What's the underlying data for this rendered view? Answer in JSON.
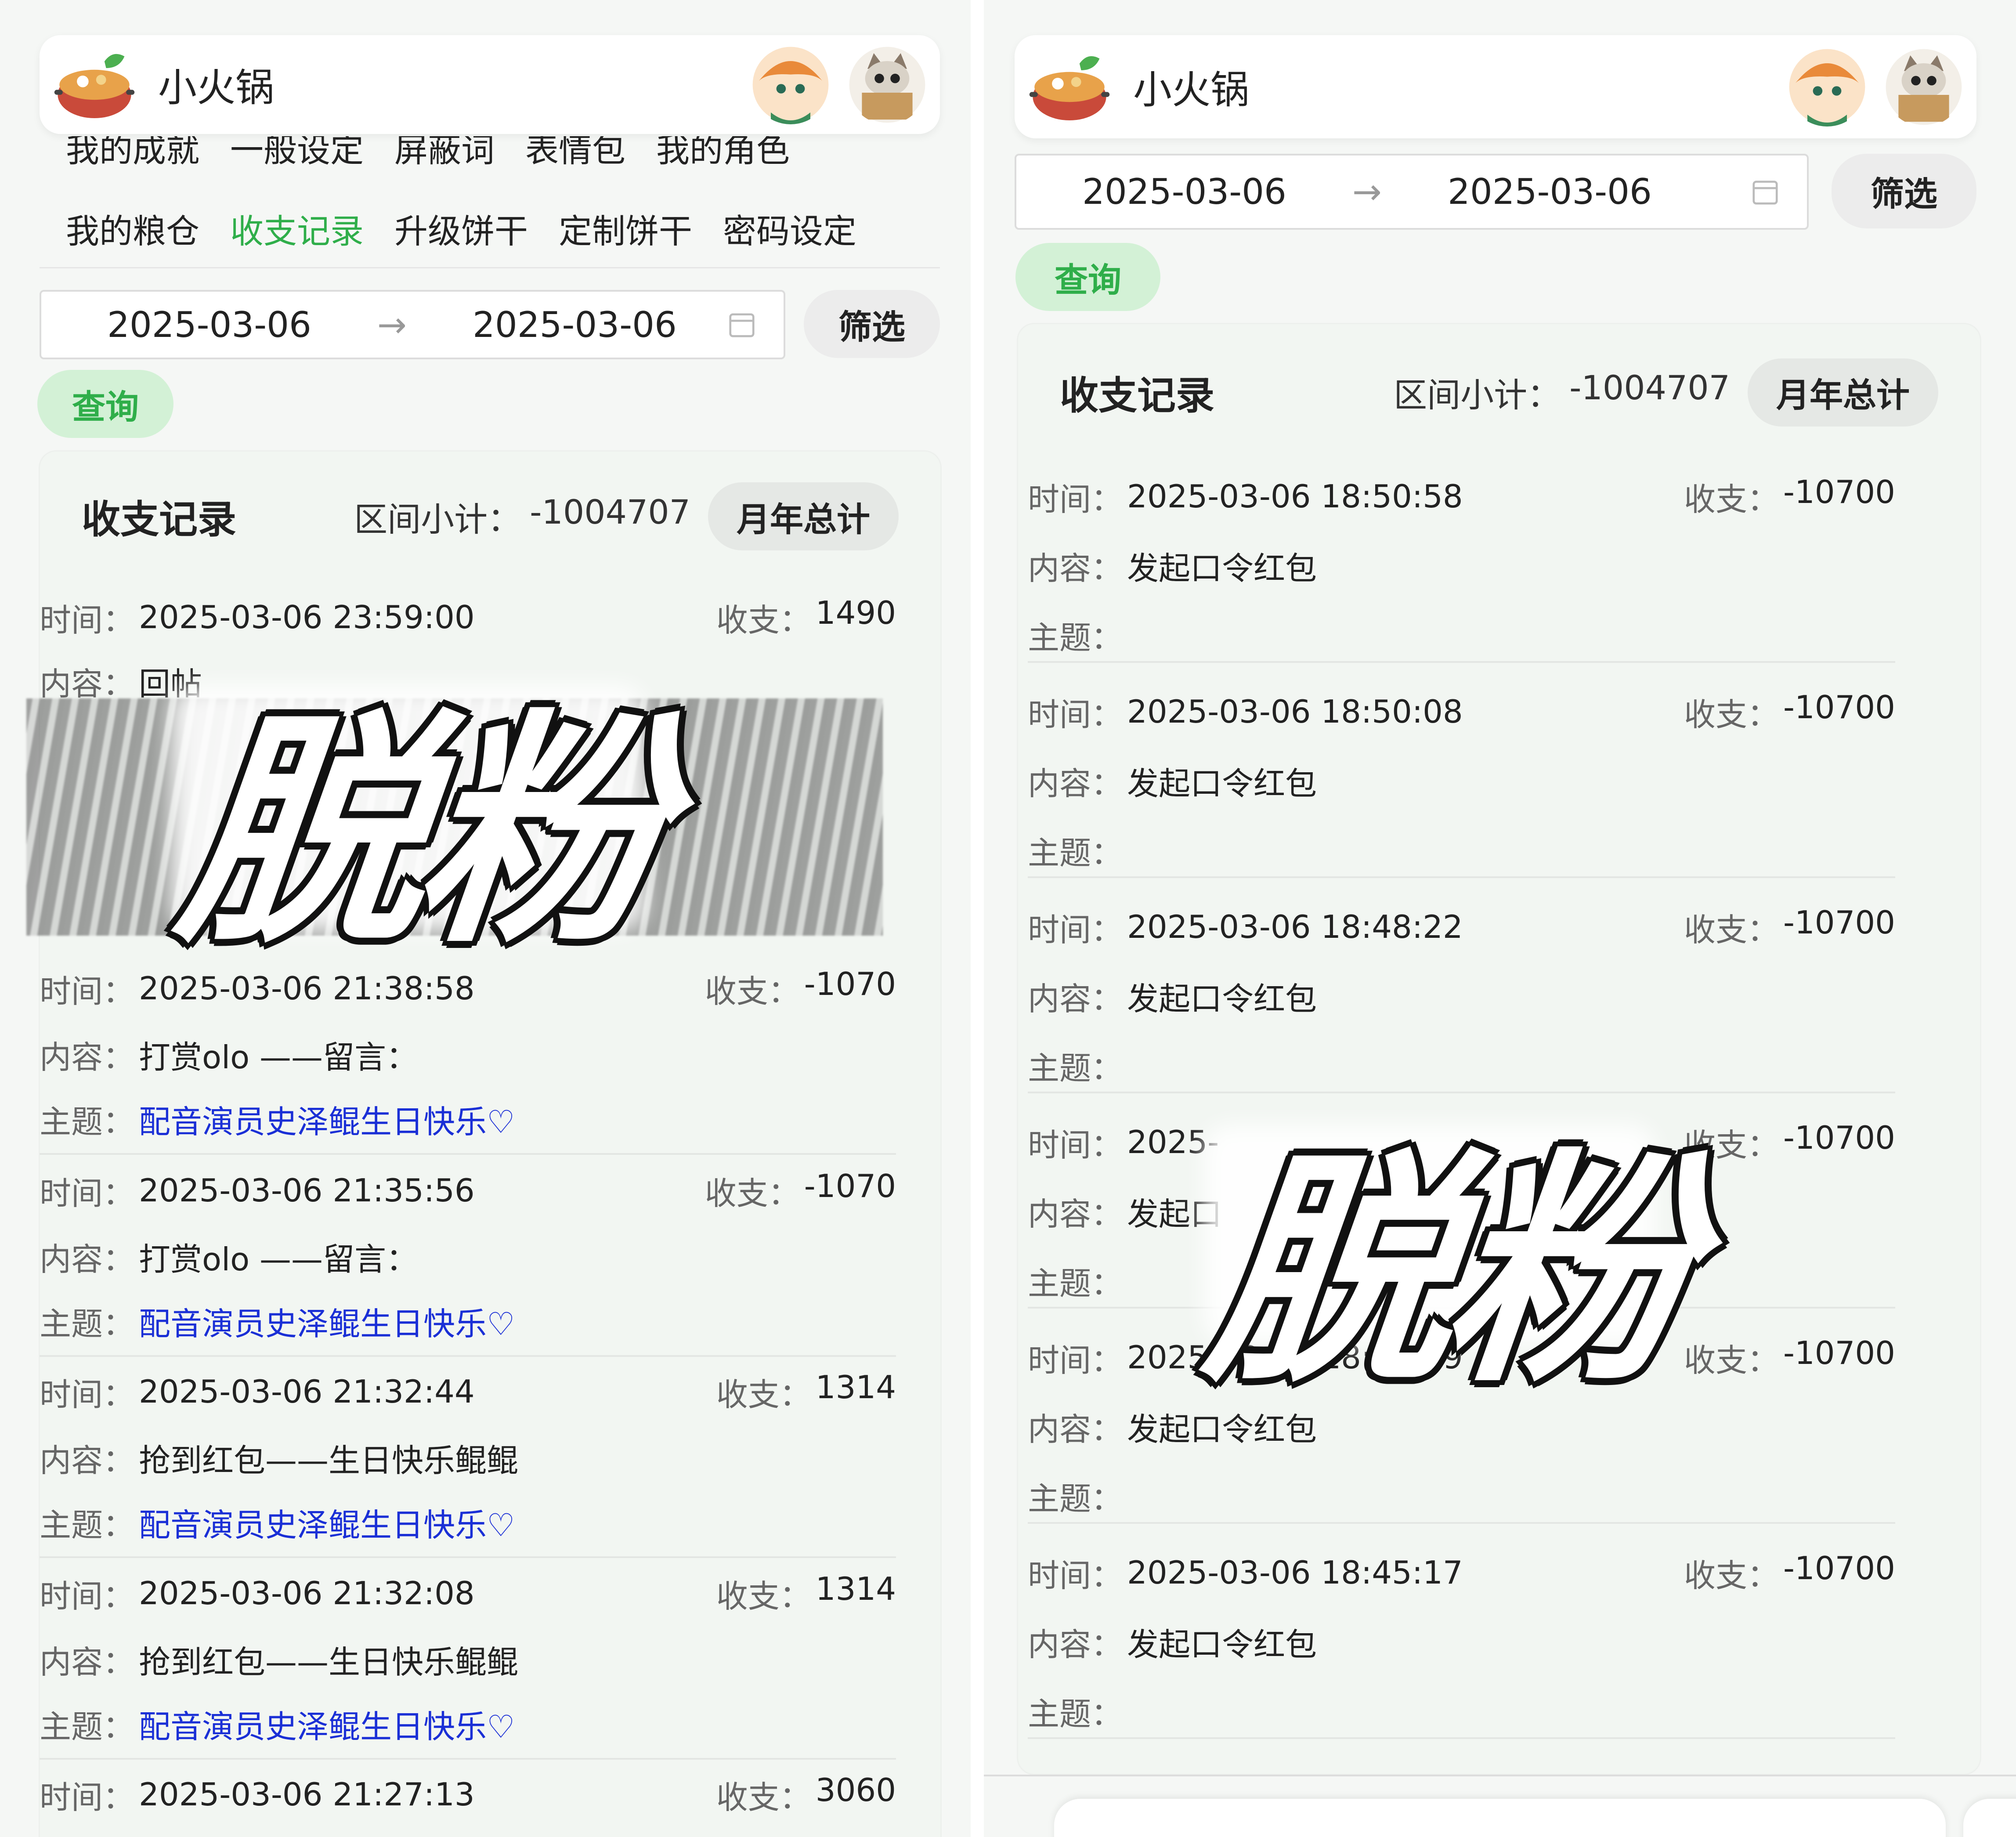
{
  "app": {
    "title": "小火锅",
    "avatars": [
      "anime-girl-avatar",
      "cat-box-avatar"
    ],
    "nav_row_1": [
      "我的成就",
      "一般设定",
      "屏蔽词",
      "表情包",
      "我的角色"
    ],
    "nav_row_2": [
      "我的粮仓",
      "收支记录",
      "升级饼干",
      "定制饼干",
      "密码设定"
    ],
    "active_tab": "收支记录"
  },
  "labels": {
    "time": "时间：",
    "content": "内容：",
    "topic": "主题：",
    "amount": "收支：",
    "date_arrow": "→",
    "filter": "筛选",
    "query": "查询",
    "card_title": "收支记录",
    "subtotal_label": "区间小计：",
    "total_button": "月年总计"
  },
  "date_range": {
    "start": "2025-03-06",
    "end": "2025-03-06"
  },
  "subtotal": "-1004707",
  "watermark": "脱粉",
  "left_records": [
    {
      "time": "2025-03-06 23:59:00",
      "amount": "1490",
      "content": "回帖",
      "topic": ""
    },
    {
      "time": "2025-03-06 21:38:58",
      "amount": "-1070",
      "content": "打赏olo ——留言：",
      "topic": "配音演员史泽鲲生日快乐♡"
    },
    {
      "time": "2025-03-06 21:35:56",
      "amount": "-1070",
      "content": "打赏olo ——留言：",
      "topic": "配音演员史泽鲲生日快乐♡"
    },
    {
      "time": "2025-03-06 21:32:44",
      "amount": "1314",
      "content": "抢到红包——生日快乐鲲鲲",
      "topic": "配音演员史泽鲲生日快乐♡"
    },
    {
      "time": "2025-03-06 21:32:08",
      "amount": "1314",
      "content": "抢到红包——生日快乐鲲鲲",
      "topic": "配音演员史泽鲲生日快乐♡"
    },
    {
      "time": "2025-03-06 21:27:13",
      "amount": "3060",
      "content": "",
      "topic": ""
    }
  ],
  "right_records": [
    {
      "time": "2025-03-06 18:50:58",
      "amount": "-10700",
      "content": "发起口令红包",
      "topic": ""
    },
    {
      "time": "2025-03-06 18:50:08",
      "amount": "-10700",
      "content": "发起口令红包",
      "topic": ""
    },
    {
      "time": "2025-03-06 18:48:22",
      "amount": "-10700",
      "content": "发起口令红包",
      "topic": ""
    },
    {
      "time": "2025-",
      "amount": "-10700",
      "content": "发起口",
      "topic": ""
    },
    {
      "time": "2025-03-06 18:45:59",
      "amount": "-10700",
      "content": "发起口令红包",
      "topic": ""
    },
    {
      "time": "2025-03-06 18:45:17",
      "amount": "-10700",
      "content": "发起口令红包",
      "topic": ""
    }
  ],
  "colors": {
    "accent": "#2fae4a",
    "accent_bg": "#d3f1d6",
    "link": "#1a2fd6",
    "card_bg": "#f2f6f2"
  }
}
